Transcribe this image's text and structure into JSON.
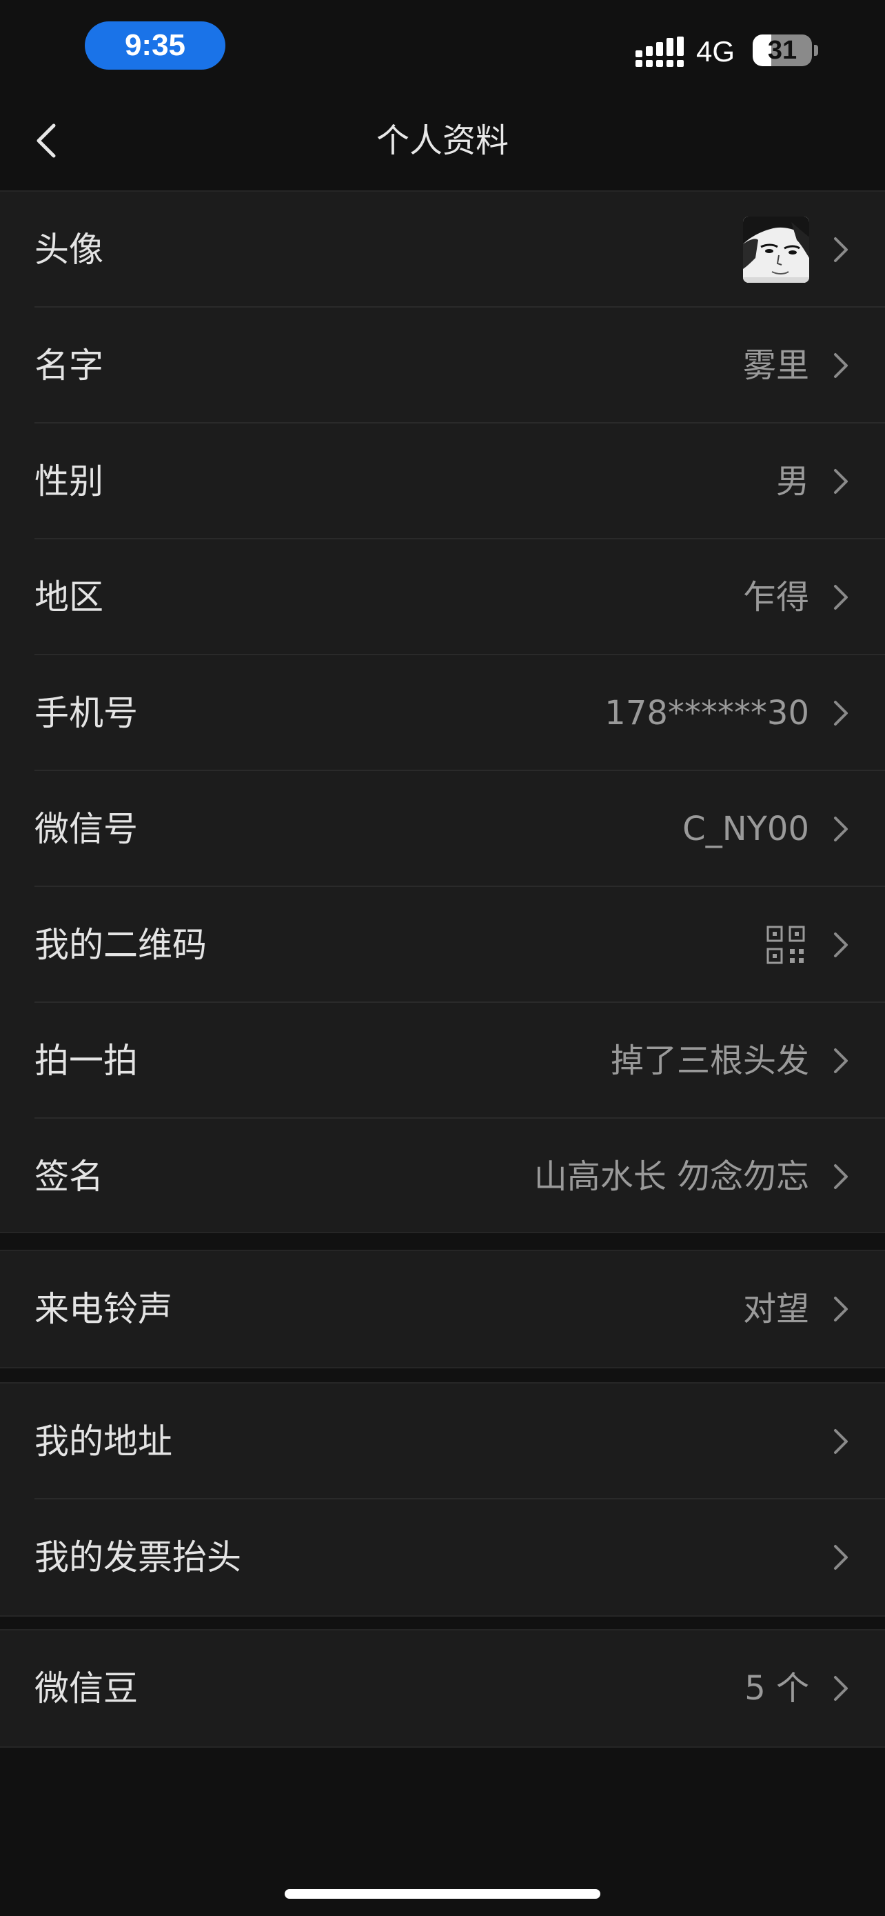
{
  "status_bar": {
    "time": "9:35",
    "network": "4G",
    "battery_level": "31",
    "battery_fraction": 0.31
  },
  "nav": {
    "title": "个人资料",
    "back_icon": "chevron-left-icon"
  },
  "groups": [
    {
      "rows": [
        {
          "label": "头像",
          "value": "",
          "kind": "avatar"
        },
        {
          "label": "名字",
          "value": "雾里"
        },
        {
          "label": "性别",
          "value": "男"
        },
        {
          "label": "地区",
          "value": "乍得"
        },
        {
          "label": "手机号",
          "value": "178******30"
        },
        {
          "label": "微信号",
          "value": "C_NY00"
        },
        {
          "label": "我的二维码",
          "value": "",
          "kind": "qr-code-icon"
        },
        {
          "label": "拍一拍",
          "value": "掉了三根头发"
        },
        {
          "label": "签名",
          "value": "山高水长 勿念勿忘"
        }
      ]
    },
    {
      "rows": [
        {
          "label": "来电铃声",
          "value": "对望"
        }
      ]
    },
    {
      "rows": [
        {
          "label": "我的地址",
          "value": ""
        },
        {
          "label": "我的发票抬头",
          "value": ""
        }
      ]
    },
    {
      "rows": [
        {
          "label": "微信豆",
          "value": "5 个"
        }
      ]
    }
  ],
  "colors": {
    "background": "#111111",
    "row_background": "#1c1c1c",
    "label_text": "#e4e4e4",
    "value_text": "#9a9a9a",
    "time_pill": "#1a73e8"
  }
}
